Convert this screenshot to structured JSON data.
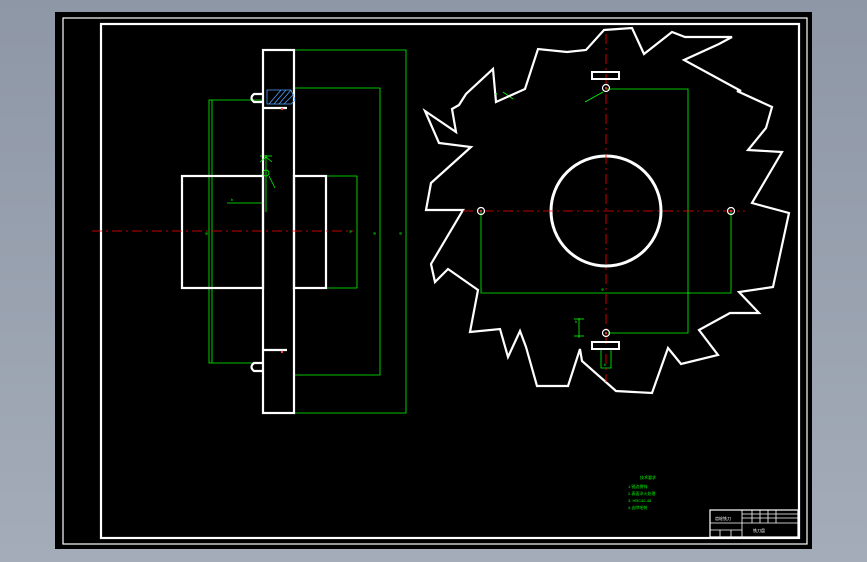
{
  "drawing": {
    "background_color": "#000000",
    "frame_color": "#ffffff",
    "dimension_color": "#00ff00",
    "centerline_color": "#ff0000",
    "hatch_color": "#4fa3ff"
  },
  "tech_notes": {
    "title": "技术要求",
    "lines": [
      "1.锐边倒钝.",
      "2.表面淬火处理.",
      "3.  HRC42-48",
      "4.去除毛刺"
    ]
  },
  "title_block": {
    "part_name": "齿轮铣刀",
    "drawing_name": "铣刀盘"
  },
  "side_view_dims": {
    "outer_height": "Φ",
    "hub_height": "Φ",
    "bore": "Φ",
    "tooth_root": "Φ",
    "keyway": "b"
  },
  "front_view_dims": {
    "bore_width": "Φ",
    "keyway_height": "h",
    "keyway_width": "b",
    "tooth_angle": "α"
  }
}
